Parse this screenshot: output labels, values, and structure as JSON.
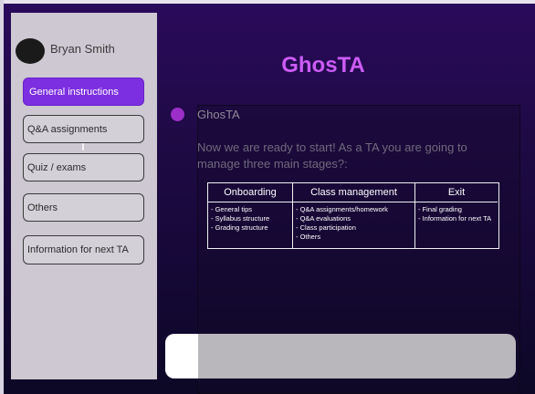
{
  "user": {
    "name": "Bryan Smith"
  },
  "sidebar": {
    "items": [
      {
        "label": "General instructions",
        "active": true
      },
      {
        "label": "Q&A assignments",
        "active": false
      },
      {
        "label": "Quiz / exams",
        "active": false
      },
      {
        "label": "Others",
        "active": false
      },
      {
        "label": "Information for next TA",
        "active": false
      }
    ]
  },
  "header": {
    "title": "GhosTA"
  },
  "chat": {
    "bot_name": "GhosTA",
    "message": "Now we are ready to start! As a TA you are going to manage three main stages?:",
    "stages": [
      {
        "title": "Onboarding",
        "items": [
          "- General tips",
          "- Syllabus structure",
          "- Grading structure"
        ]
      },
      {
        "title": "Class management",
        "items": [
          "- Q&A assignments/homework",
          "- Q&A evaluations",
          "- Class participation",
          "- Others"
        ]
      },
      {
        "title": "Exit",
        "items": [
          "- Final grading",
          "- Information for next TA"
        ]
      }
    ]
  },
  "input": {
    "value": "",
    "placeholder": ""
  },
  "colors": {
    "accent": "#7c2fe0",
    "title": "#cc5cf5",
    "bot_dot": "#9b2fc8",
    "sidebar": "#cdc8d2"
  }
}
